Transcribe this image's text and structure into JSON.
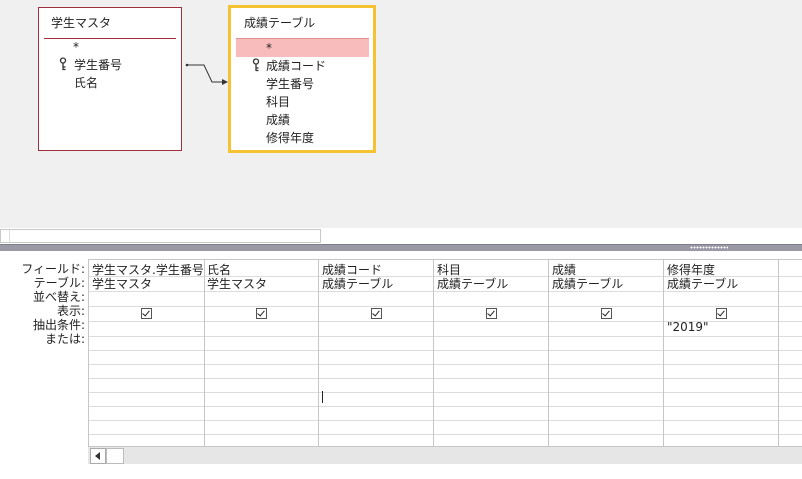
{
  "tables": [
    {
      "title": "学生マスタ",
      "fields": [
        "*",
        "学生番号",
        "氏名"
      ],
      "key_field": "学生番号"
    },
    {
      "title": "成績テーブル",
      "fields": [
        "*",
        "成績コード",
        "科目",
        "成績",
        "修得年度"
      ],
      "key_field": "成績コード"
    }
  ],
  "row_labels": [
    "フィールド:",
    "テーブル:",
    "並べ替え:",
    "表示:",
    "抽出条件:",
    "または:"
  ],
  "columns": [
    {
      "field": "学生マスタ.学生番号",
      "table": "学生マスタ",
      "sort": "",
      "show": true,
      "criteria": ""
    },
    {
      "field": "氏名",
      "table": "学生マスタ",
      "sort": "",
      "show": true,
      "criteria": ""
    },
    {
      "field": "成績コード",
      "table": "成績テーブル",
      "sort": "",
      "show": true,
      "criteria": ""
    },
    {
      "field": "科目",
      "table": "成績テーブル",
      "sort": "",
      "show": true,
      "criteria": ""
    },
    {
      "field": "成績",
      "table": "成績テーブル",
      "sort": "",
      "show": true,
      "criteria": ""
    },
    {
      "field": "修得年度",
      "table": "成績テーブル",
      "sort": "",
      "show": true,
      "criteria": "\"2019\""
    }
  ]
}
